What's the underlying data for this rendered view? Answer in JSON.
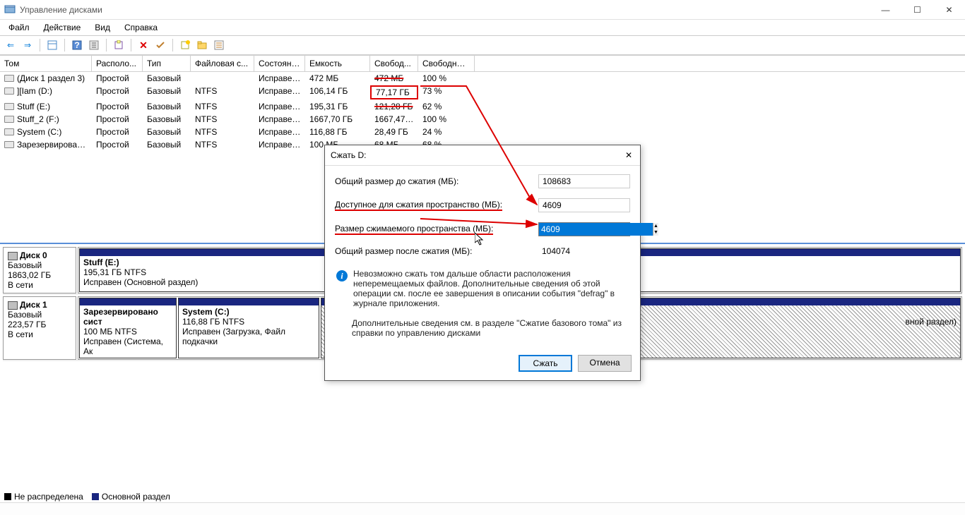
{
  "window": {
    "title": "Управление дисками",
    "controls": {
      "min": "—",
      "max": "☐",
      "close": "✕"
    }
  },
  "menu": {
    "file": "Файл",
    "action": "Действие",
    "view": "Вид",
    "help": "Справка"
  },
  "table": {
    "headers": {
      "volume": "Том",
      "layout": "Располо...",
      "type": "Тип",
      "fs": "Файловая с...",
      "status": "Состояние",
      "capacity": "Емкость",
      "free": "Свобод...",
      "freepct": "Свободно %"
    },
    "rows": [
      {
        "name": "(Диск 1 раздел 3)",
        "layout": "Простой",
        "type": "Базовый",
        "fs": "",
        "status": "Исправен...",
        "cap": "472 МБ",
        "free": "472 МБ",
        "pct": "100 %"
      },
      {
        "name": "][Iam (D:)",
        "layout": "Простой",
        "type": "Базовый",
        "fs": "NTFS",
        "status": "Исправен...",
        "cap": "106,14 ГБ",
        "free": "77,17 ГБ",
        "pct": "73 %"
      },
      {
        "name": "Stuff (E:)",
        "layout": "Простой",
        "type": "Базовый",
        "fs": "NTFS",
        "status": "Исправен...",
        "cap": "195,31 ГБ",
        "free": "121,28 ГБ",
        "pct": "62 %"
      },
      {
        "name": "Stuff_2 (F:)",
        "layout": "Простой",
        "type": "Базовый",
        "fs": "NTFS",
        "status": "Исправен...",
        "cap": "1667,70 ГБ",
        "free": "1667,47 ...",
        "pct": "100 %"
      },
      {
        "name": "System (C:)",
        "layout": "Простой",
        "type": "Базовый",
        "fs": "NTFS",
        "status": "Исправен...",
        "cap": "116,88 ГБ",
        "free": "28,49 ГБ",
        "pct": "24 %"
      },
      {
        "name": "Зарезервировано...",
        "layout": "Простой",
        "type": "Базовый",
        "fs": "NTFS",
        "status": "Исправен...",
        "cap": "100 МБ",
        "free": "68 МБ",
        "pct": "68 %"
      }
    ]
  },
  "disks": [
    {
      "title": "Диск 0",
      "type": "Базовый",
      "size": "1863,02 ГБ",
      "status": "В сети",
      "parts": [
        {
          "name": "Stuff  (E:)",
          "info": "195,31 ГБ NTFS",
          "status": "Исправен (Основной раздел)"
        }
      ]
    },
    {
      "title": "Диск 1",
      "type": "Базовый",
      "size": "223,57 ГБ",
      "status": "В сети",
      "parts": [
        {
          "name": "Зарезервировано сист",
          "info": "100 МБ NTFS",
          "status": "Исправен (Система, Ак"
        },
        {
          "name": "System  (C:)",
          "info": "116,88 ГБ NTFS",
          "status": "Исправен (Загрузка, Файл подкачки"
        },
        {
          "name": "",
          "info": "вной раздел)",
          "status": ""
        }
      ]
    }
  ],
  "legend": {
    "unalloc": "Не распределена",
    "primary": "Основной раздел"
  },
  "dialog": {
    "title": "Сжать D:",
    "row1_label": "Общий размер до сжатия (МБ):",
    "row1_val": "108683",
    "row2_label": "Доступное для сжатия пространство (МБ):",
    "row2_val": "4609",
    "row3_label": "Размер сжимаемого пространства (МБ):",
    "row3_val": "4609",
    "row4_label": "Общий размер после сжатия (МБ):",
    "row4_val": "104074",
    "info1": "Невозможно сжать том дальше области расположения неперемещаемых файлов. Дополнительные сведения об этой операции см. после ее завершения в описании события \"defrag\" в журнале приложения.",
    "info2": "Дополнительные сведения см. в разделе \"Сжатие базового тома\" из справки по управлению дисками",
    "btn_ok": "Сжать",
    "btn_cancel": "Отмена"
  }
}
